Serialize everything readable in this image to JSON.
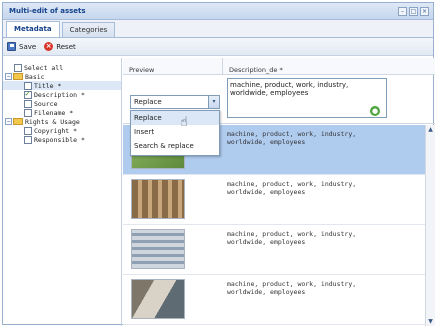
{
  "window": {
    "title": "Multi-edit of assets"
  },
  "tabs": [
    {
      "label": "Metadata"
    },
    {
      "label": "Categories"
    }
  ],
  "toolbar": {
    "save_label": "Save",
    "reset_label": "Reset"
  },
  "tree": {
    "select_all": "Select all",
    "basic": "Basic",
    "title": "Title *",
    "description": "Description *",
    "source": "Source",
    "filename": "Filename *",
    "rights": "Rights & Usage",
    "copyright": "Copyright *",
    "responsible": "Responsible *"
  },
  "columns": {
    "preview": "Preview",
    "description": "Description_de *"
  },
  "editor": {
    "mode_value": "Replace",
    "description_value": "machine, product, work, industry, worldwide, employees",
    "options": [
      "Replace",
      "Insert",
      "Search & replace"
    ]
  },
  "rows": [
    {
      "text": "machine, product, work, industry, worldwide, employees"
    },
    {
      "text": "machine, product, work, industry, worldwide, employees"
    },
    {
      "text": "machine, product, work, industry, worldwide, employees"
    },
    {
      "text": "machine, product, work, industry, worldwide, employees"
    }
  ],
  "icons": {
    "save": "save-icon",
    "reset": "reset-icon",
    "ok": "checkmark-icon",
    "dropdown": "chevron-down-icon"
  }
}
